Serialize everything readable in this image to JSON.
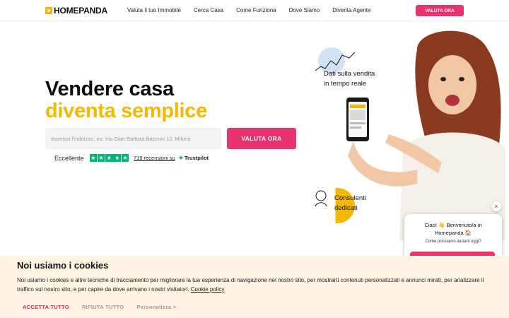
{
  "header": {
    "logo": "HOMEPANDA",
    "nav": [
      "Valuta il tuo Immobile",
      "Cerca Casa",
      "Come Funziona",
      "Dove Siamo",
      "Diventa Agente"
    ],
    "cta": "VALUTA ORA"
  },
  "hero": {
    "title_line1": "Vendere casa",
    "title_line2": "diventa semplice",
    "search_placeholder": "Inserisci l'indirizzo, es: Via Gian Battista Bazzoni 12, Milono",
    "search_button": "VALUTA ORA",
    "rating_label": "Eccellente",
    "reviews": "719 recensioni su",
    "trustpilot": "Trustpilot",
    "colors": {
      "accent": "#e8336e",
      "highlight": "#f5b800",
      "trustpilot": "#00b67a"
    }
  },
  "illustration": {
    "data_label_line1": "Dati sulla vendita",
    "data_label_line2": "in tempo reale",
    "consult_line1": "Consulenti",
    "consult_line2": "dedicati"
  },
  "chat": {
    "close": "×",
    "title_line1": "Ciao! 👋 Benvenuto/a in",
    "title_line2": "Homepanda 🏠",
    "subtitle": "Come possiamo aiutarti oggi?"
  },
  "cookie": {
    "title": "Noi usiamo i cookies",
    "text": "Noi usiamo i cookies e altre tecniche di tracciamento per migliorare la tua esperienza di navigazione nel nostro sito, per mostrarti contenuti personalizzati e annunci mirati, per analizzare il traffico sul nostro sito, e per capire da dove arrivano i nostri visitatori.",
    "link": "Cookie policy",
    "accept": "ACCETTA TUTTO",
    "reject": "RIFIUTA TUTTO",
    "customize": "Personalizza >"
  }
}
